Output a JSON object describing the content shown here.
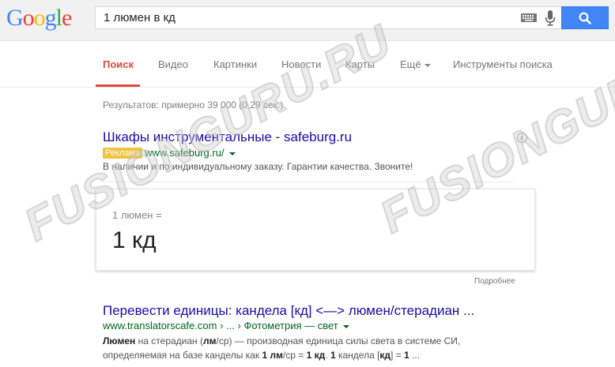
{
  "header": {
    "logo_letters": [
      {
        "ch": "G",
        "color": "#4285f4"
      },
      {
        "ch": "o",
        "color": "#ea4335"
      },
      {
        "ch": "o",
        "color": "#fbbc05"
      },
      {
        "ch": "g",
        "color": "#4285f4"
      },
      {
        "ch": "l",
        "color": "#34a853"
      },
      {
        "ch": "e",
        "color": "#ea4335"
      }
    ],
    "search_query": "1 люмен в кд",
    "keyboard_icon": "keyboard-icon",
    "mic_icon": "microphone-icon",
    "search_icon": "magnifier-icon",
    "accent": "#4285f4"
  },
  "nav": {
    "items": [
      {
        "label": "Поиск",
        "active": true
      },
      {
        "label": "Видео"
      },
      {
        "label": "Картинки"
      },
      {
        "label": "Новости"
      },
      {
        "label": "Карты"
      },
      {
        "label": "Ещё"
      },
      {
        "label": "Инструменты поиска"
      }
    ],
    "active_color": "#dd4b39"
  },
  "stats": "Результатов: примерно 39 000 (0,29 сек.)",
  "ad": {
    "title": "Шкафы инструментальные - safeburg.ru",
    "badge": "Реклама",
    "url": "www.safeburg.ru/",
    "description": "В наличии и по индивидуальному заказу. Гарантии качества. Звоните!",
    "info_icon": "info-icon"
  },
  "converter": {
    "from": "1 люмен =",
    "to": "1 кд",
    "more": "Подробнее"
  },
  "result": {
    "title": "Перевести единицы: кандела [кд] <—> люмен/стерадиан ...",
    "url_host": "www.translatorscafe.com",
    "url_path": " › ... › Фотометрия — свет",
    "snippet": {
      "s1": "Люмен",
      "s2": " на стерадиан (",
      "s3": "лм",
      "s4": "/ср) — производная единица силы света в системе СИ, определяемая на базе канделы как ",
      "s5": "1 лм",
      "s6": "/ср = ",
      "s7": "1 кд",
      "s8": ". ",
      "s9": "1",
      "s10": " кандела [",
      "s11": "кд",
      "s12": "] = ",
      "s13": "1",
      "s14": " ..."
    }
  },
  "watermark": "FUSIONGURU.RU"
}
